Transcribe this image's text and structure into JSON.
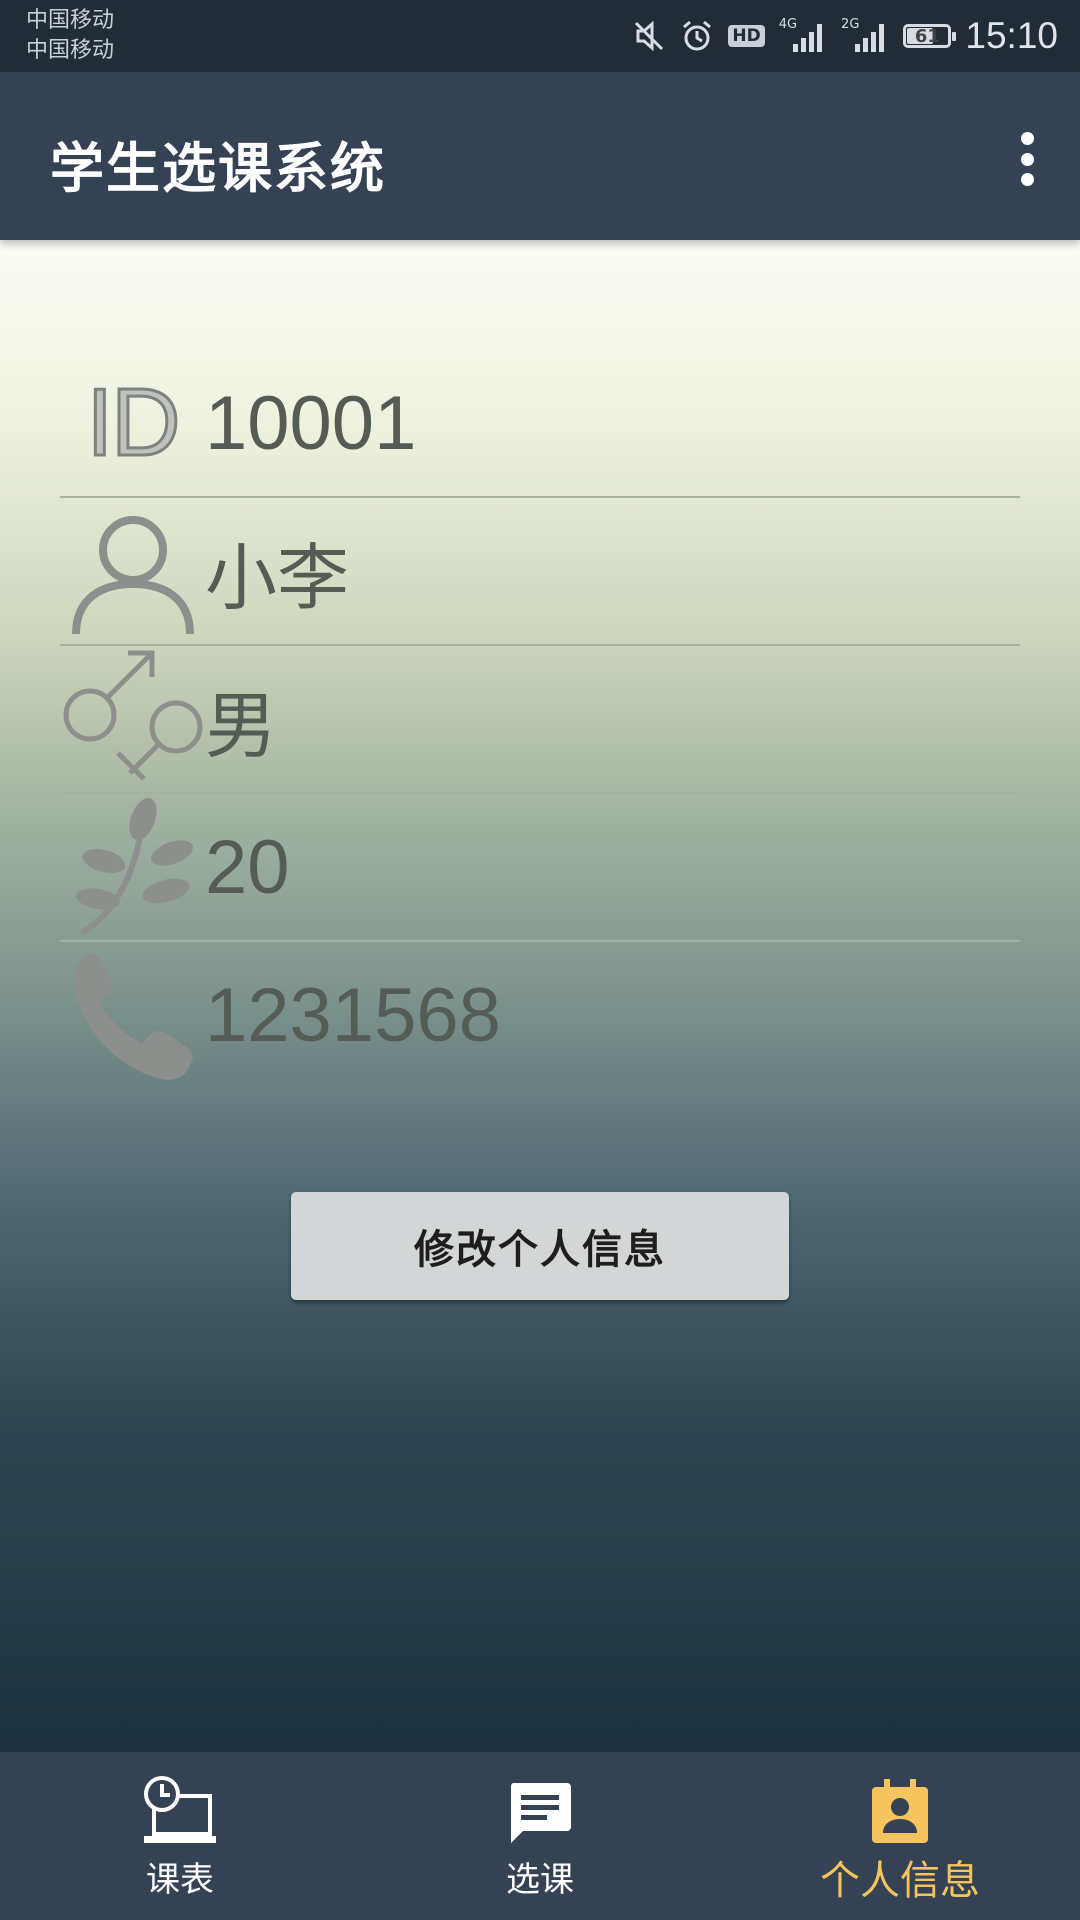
{
  "status_bar": {
    "carrier_1": "中国移动",
    "carrier_2": "中国移动",
    "hd_label": "HD",
    "net_1": "4G",
    "net_2": "2G",
    "battery": "61",
    "time": "15:10",
    "icons": [
      "mute-icon",
      "alarm-icon",
      "hd-icon",
      "signal-4g-icon",
      "signal-2g-icon",
      "battery-icon"
    ]
  },
  "app_bar": {
    "title": "学生选课系统",
    "menu_icon": "more-vert-icon"
  },
  "profile": {
    "id": "10001",
    "name": "小李",
    "gender": "男",
    "age": "20",
    "phone": "1231568",
    "id_icon_text": "ID"
  },
  "edit_button": {
    "label": "修改个人信息"
  },
  "bottom_nav": {
    "items": [
      {
        "label": "课表",
        "icon": "schedule-icon",
        "active": false
      },
      {
        "label": "选课",
        "icon": "message-icon",
        "active": false
      },
      {
        "label": "个人信息",
        "icon": "contact-card-icon",
        "active": true
      }
    ],
    "active_color": "#f5c45e"
  },
  "colors": {
    "app_bar": "#354254",
    "status_bar": "#222c36",
    "button": "#d3d6d6"
  }
}
